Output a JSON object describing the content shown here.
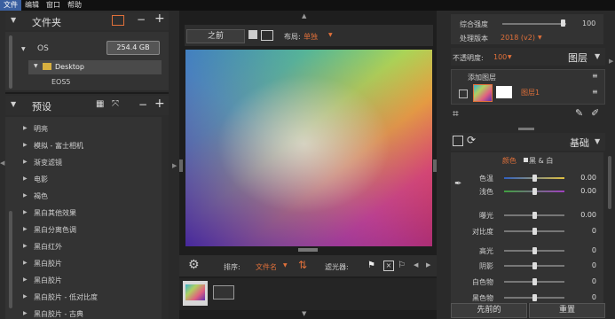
{
  "menu": [
    "文件",
    "编辑",
    "窗口",
    "帮助"
  ],
  "folders": {
    "title": "文件夹",
    "drive_name": "OS",
    "drive_size": "254.4 GB",
    "selected_folder": "Desktop",
    "sub_item": "EOS5"
  },
  "presets": {
    "title": "预设",
    "items": [
      "明亮",
      "模拟 - 富士相机",
      "渐变滤镜",
      "电影",
      "褐色",
      "黑白其他效果",
      "黑白分离色调",
      "黑白红外",
      "黑白胶片",
      "黑白胶片",
      "黑白胶片 - 低对比度",
      "黑白胶片 - 古典"
    ]
  },
  "toolbar": {
    "before_label": "之前",
    "layout_label": "布局:",
    "layout_value": "单独"
  },
  "filmstrip": {
    "sort_label": "排序:",
    "sort_value": "文件名",
    "filter_label": "滤光器:"
  },
  "right_top": {
    "strength_label": "综合强度",
    "strength_value": "100",
    "strength_level": 0.95,
    "version_label": "处理版本",
    "version_value": "2018 (v2)",
    "opacity_label": "不透明度:",
    "opacity_value": "100",
    "layers_label": "图层",
    "add_layer": "添加图层",
    "layer1_name": "图层1"
  },
  "basic": {
    "title": "基础",
    "tab_color": "颜色",
    "tab_bw": "黑 & 白",
    "rows": [
      {
        "label": "色温",
        "value": "0.00",
        "level": 0.5
      },
      {
        "label": "浅色",
        "value": "0.00",
        "level": 0.5
      },
      {
        "label": "曝光",
        "value": "0.00",
        "level": 0.5
      },
      {
        "label": "对比度",
        "value": "0",
        "level": 0.5
      },
      {
        "label": "高光",
        "value": "0",
        "level": 0.5
      },
      {
        "label": "阴影",
        "value": "0",
        "level": 0.5
      },
      {
        "label": "白色物",
        "value": "0",
        "level": 0.5
      },
      {
        "label": "黑色物",
        "value": "0",
        "level": 0.5
      }
    ],
    "prev_button": "先前的",
    "reset_button": "重置"
  },
  "colors": {
    "accent": "#e0703a",
    "selected": "#4a4a4a"
  }
}
